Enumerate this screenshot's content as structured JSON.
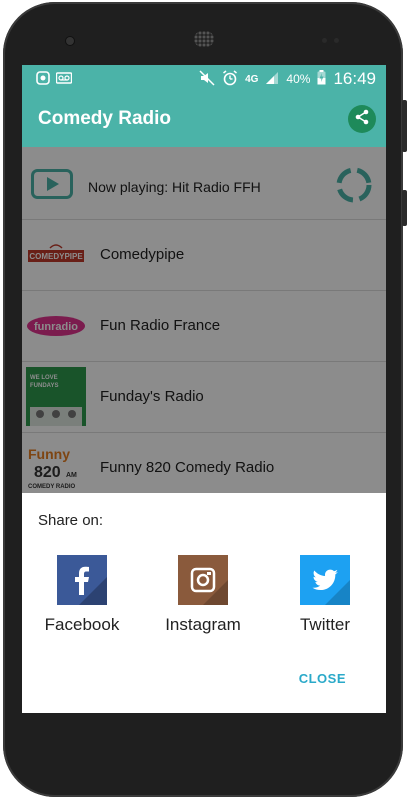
{
  "status_bar": {
    "time": "16:49",
    "battery_percent": "40%",
    "network": "4G"
  },
  "app": {
    "title": "Comedy Radio"
  },
  "now_playing": {
    "label": "Now playing:",
    "station": "Hit Radio FFH"
  },
  "stations": [
    {
      "name": "Comedypipe",
      "logo_text": "COMEDYPIPE"
    },
    {
      "name": "Fun Radio France",
      "logo_text": "funradio"
    },
    {
      "name": "Funday's Radio",
      "logo_text": "WE LOVE FUNDAYS"
    },
    {
      "name": "Funny 820 Comedy Radio",
      "logo_text": "Funny 820AM COMEDY RADIO"
    }
  ],
  "share_sheet": {
    "title": "Share on:",
    "options": [
      {
        "label": "Facebook",
        "icon": "facebook-icon",
        "color": "#3b5998"
      },
      {
        "label": "Instagram",
        "icon": "instagram-icon",
        "color": "#8a5a3c"
      },
      {
        "label": "Twitter",
        "icon": "twitter-icon",
        "color": "#1da1f2"
      }
    ],
    "close_label": "CLOSE"
  },
  "colors": {
    "accent": "#4bb3a8",
    "share_fab": "#1e8a5a",
    "close": "#2aa9c9"
  }
}
